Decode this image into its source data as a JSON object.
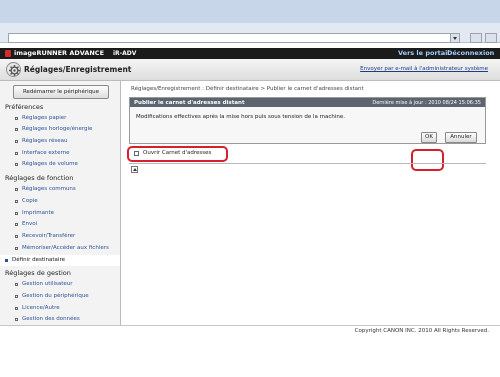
{
  "app": {
    "brand": "imageRUNNER ADVANCE",
    "model": "iR-ADV",
    "portal_link": "Vers le portail",
    "logout_link": "Déconnexion"
  },
  "page": {
    "title": "Réglages/Enregistrement",
    "email_link": "Envoyer par e-mail à l'administrateur système"
  },
  "sidebar": {
    "restart_button": "Redémarrer le périphérique",
    "preferences": {
      "heading": "Préférences",
      "items": [
        "Réglages papier",
        "Réglages horloge/énergie",
        "Réglages réseau",
        "Interface externe",
        "Réglages de volume"
      ]
    },
    "functions": {
      "heading": "Réglages de fonction",
      "items": [
        "Réglages communs",
        "Copie",
        "Imprimante",
        "Envoi",
        "Recevoir/Transférer",
        "Mémoriser/Accéder aux fichiers"
      ]
    },
    "active_item": "Définir destinataire",
    "management": {
      "heading": "Réglages de gestion",
      "items": [
        "Gestion utilisateur",
        "Gestion du périphérique",
        "Licence/Autre",
        "Gestion des données"
      ]
    }
  },
  "main": {
    "breadcrumb": "Réglages/Enregistrement : Définir destinataire > Publier le carnet d'adresses distant",
    "panel": {
      "title": "Publier le carnet d'adresses distant",
      "last_update": "Dernière mise à jour : 2010 08/24 15:06:35",
      "message": "Modifications effectives après la mise hors puis sous tension de la machine.",
      "ok_label": "OK",
      "cancel_label": "Annuler"
    },
    "checkbox_label": "Ouvrir Carnet d'adresses",
    "checkbox_checked": false
  },
  "footer": {
    "copyright": "Copyright CANON INC. 2010 All Rights Reserved."
  },
  "colors": {
    "highlight": "#d6202c",
    "header_bg": "#1b1b1b",
    "link": "#2b4f98",
    "panel_head": "#5c6470"
  }
}
